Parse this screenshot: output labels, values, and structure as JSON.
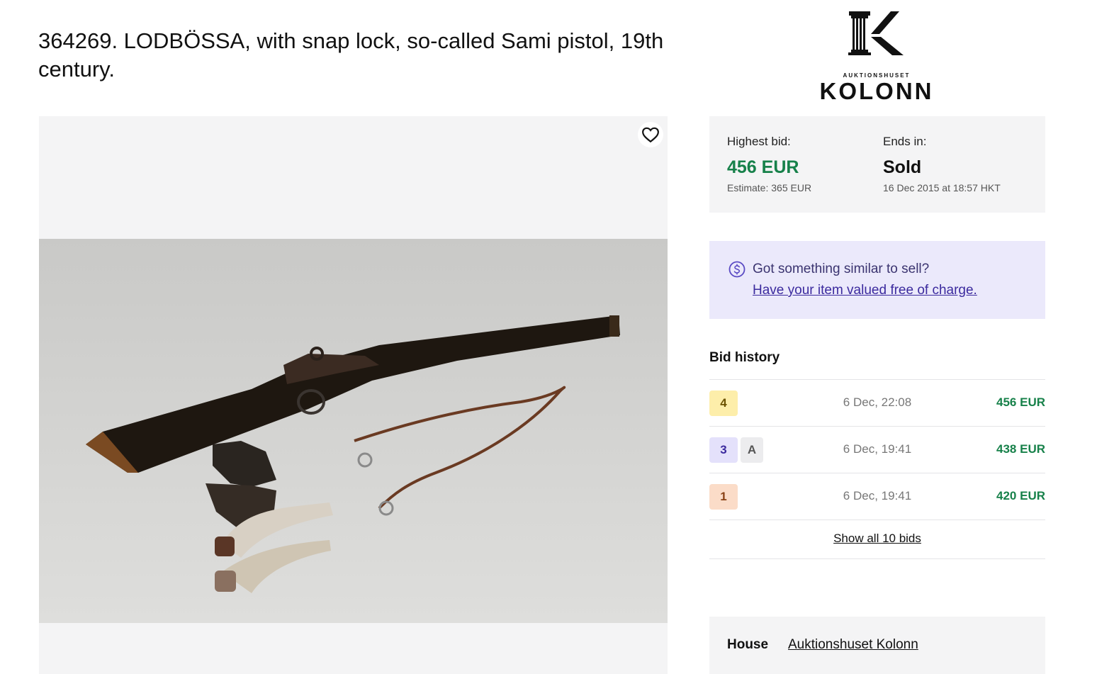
{
  "lot": {
    "title": "364269. LODBÖSSA, with snap lock, so-called Sami pistol, 19th century."
  },
  "logo": {
    "small_text": "AUKTIONSHUSET",
    "big_text": "KOLONN"
  },
  "favorite": {
    "icon": "heart-icon"
  },
  "bid": {
    "highest_label": "Highest bid:",
    "highest_value": "456 EUR",
    "estimate": "Estimate: 365 EUR",
    "ends_label": "Ends in:",
    "ends_value": "Sold",
    "ends_date": "16 Dec 2015 at 18:57 HKT"
  },
  "sell": {
    "icon": "dollar-circle-icon",
    "question": "Got something similar to sell?",
    "link": "Have your item valued free of charge."
  },
  "history": {
    "title": "Bid history",
    "rows": [
      {
        "bidder": "4",
        "extra": "",
        "date": "6 Dec, 22:08",
        "amount": "456 EUR"
      },
      {
        "bidder": "3",
        "extra": "A",
        "date": "6 Dec, 19:41",
        "amount": "438 EUR"
      },
      {
        "bidder": "1",
        "extra": "",
        "date": "6 Dec, 19:41",
        "amount": "420 EUR"
      }
    ],
    "show_all": "Show all 10 bids"
  },
  "house": {
    "label": "House",
    "link": "Auktionshuset Kolonn"
  },
  "colors": {
    "accent_green": "#17814a",
    "promo_bg": "#ebe9fb",
    "panel_bg": "#f4f4f5"
  }
}
